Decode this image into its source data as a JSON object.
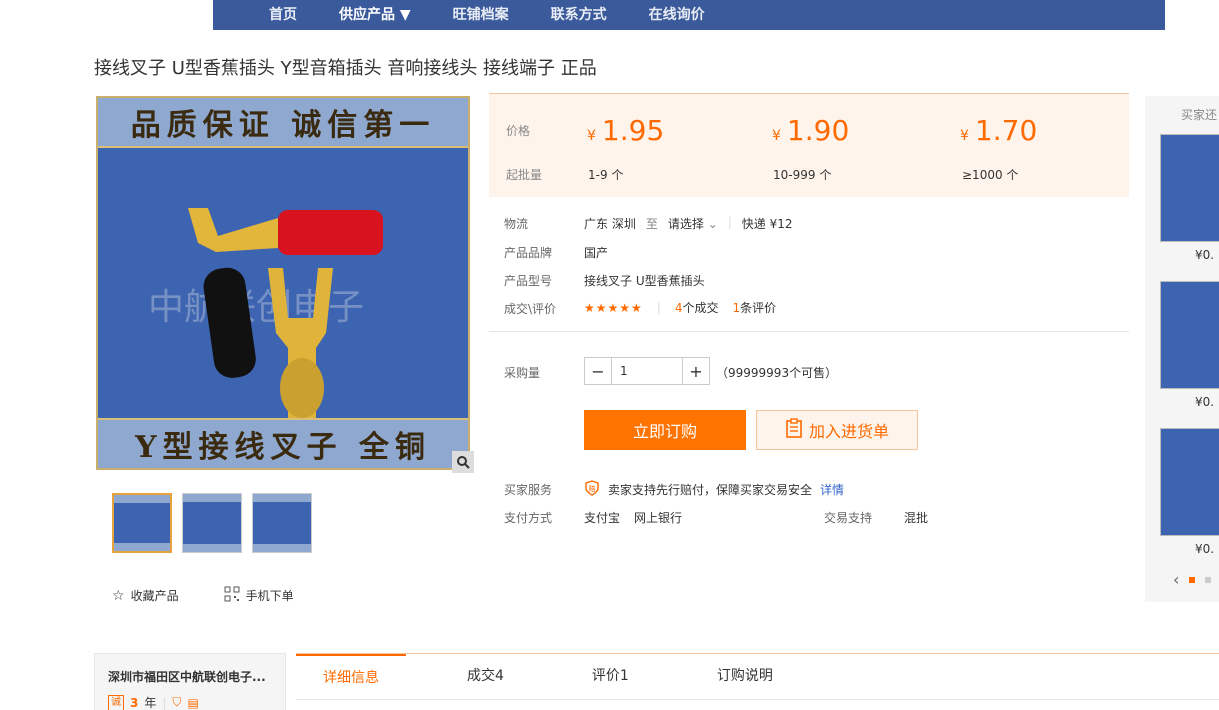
{
  "nav": {
    "items": [
      "首页",
      "供应产品 ▼",
      "旺铺档案",
      "联系方式",
      "在线询价"
    ]
  },
  "product": {
    "title": "接线叉子 U型香蕉插头 Y型音箱插头 音响接线头 接线端子 正品",
    "image_banner_top": "品质保证 诚信第一",
    "image_banner_bottom": "Y型接线叉子 全铜",
    "image_watermark": "中航联创电子"
  },
  "price": {
    "price_label": "价格",
    "moq_label": "起批量",
    "currency": "¥",
    "tiers": [
      {
        "price": "1.95",
        "moq": "1-9 个"
      },
      {
        "price": "1.90",
        "moq": "10-999 个"
      },
      {
        "price": "1.70",
        "moq": "≥1000 个"
      }
    ]
  },
  "logistics": {
    "label": "物流",
    "origin": "广东 深圳",
    "to": "至",
    "destination": "请选择",
    "shipping": "快递 ¥12"
  },
  "brand": {
    "label": "产品品牌",
    "value": "国产"
  },
  "model": {
    "label": "产品型号",
    "value": "接线叉子 U型香蕉插头"
  },
  "rating": {
    "label": "成交\\评价",
    "stars": "★★★★★",
    "deals_count": "4",
    "deals_suffix": "个成交",
    "reviews_count": "1",
    "reviews_suffix": "条评价"
  },
  "purchase": {
    "label": "采购量",
    "quantity": "1",
    "available": "（99999993个可售）",
    "buy_label": "立即订购",
    "cart_label": "加入进货单"
  },
  "service": {
    "label": "买家服务",
    "text": "卖家支持先行赔付，保障买家交易安全",
    "link": "详情"
  },
  "payment": {
    "label": "支付方式",
    "methods": [
      "支付宝",
      "网上银行"
    ],
    "trade_label": "交易支持",
    "trade_value": "混批"
  },
  "actions": {
    "favorite": "收藏产品",
    "mobile": "手机下单"
  },
  "side": {
    "title": "买家还",
    "prices": [
      "¥0.",
      "¥0.",
      "¥0."
    ]
  },
  "shop": {
    "name": "深圳市福田区中航联创电子...",
    "years_num": "3",
    "years_unit": "年"
  },
  "tabs": [
    "详细信息",
    "成交4",
    "评价1",
    "订购说明"
  ],
  "colors": {
    "accent": "#ff6a00",
    "nav_bg": "#3a5a9b",
    "price_bg": "#fff4ec"
  }
}
